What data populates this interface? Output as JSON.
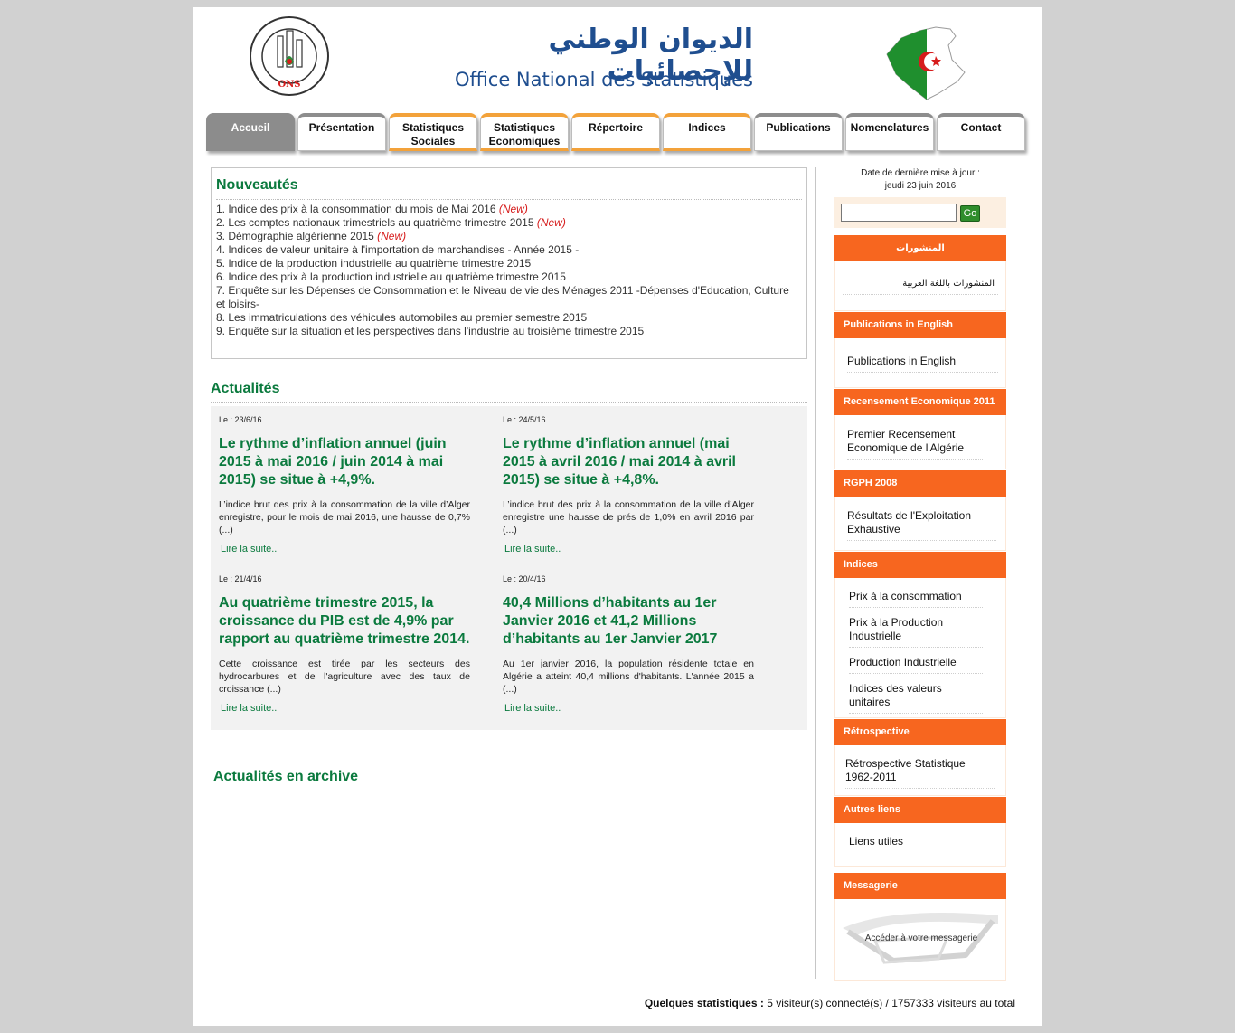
{
  "header": {
    "title_ar": "الديوان الوطني للإحصائيات",
    "title_fr": "Office National des Statistiques",
    "logo_text": "ONS",
    "logo_arc_text": "الديوان الوطني للإحصائيات"
  },
  "nav": [
    {
      "label": "Accueil",
      "active": true
    },
    {
      "label": "Présentation"
    },
    {
      "label": "Statistiques Sociales"
    },
    {
      "label": "Statistiques Economiques"
    },
    {
      "label": "Répertoire"
    },
    {
      "label": "Indices"
    },
    {
      "label": "Publications"
    },
    {
      "label": "Nomenclatures"
    },
    {
      "label": "Contact"
    }
  ],
  "nouveautes": {
    "title": "Nouveautés",
    "new_tag": "(New)",
    "items": [
      {
        "text": "1. Indice des prix à la consommation du mois de Mai 2016",
        "is_new": true
      },
      {
        "text": "2. Les comptes nationaux trimestriels au quatrième trimestre 2015",
        "is_new": true
      },
      {
        "text": "3. Démographie algérienne 2015",
        "is_new": true
      },
      {
        "text": "4. Indices de valeur unitaire à l'importation de marchandises - Année 2015 -"
      },
      {
        "text": "5. Indice de la production industrielle au quatrième trimestre 2015"
      },
      {
        "text": "6. Indice des prix à la production industrielle au quatrième trimestre 2015"
      },
      {
        "text": "7. Enquête sur les Dépenses de Consommation et le Niveau de vie des Ménages 2011 -Dépenses d'Education, Culture et loisirs-"
      },
      {
        "text": "8. Les immatriculations des véhicules automobiles au premier semestre 2015"
      },
      {
        "text": "9. Enquête sur la situation et les perspectives dans l'industrie au troisième trimestre 2015"
      }
    ]
  },
  "actualites": {
    "title": "Actualités",
    "more_label": "Lire la suite..",
    "items": [
      {
        "date": "Le : 23/6/16",
        "headline": "Le rythme d’inflation annuel (juin 2015 à mai 2016 / juin 2014 à mai 2015) se situe à +4,9%.",
        "body": "L’indice brut des prix à la consommation de la ville d’Alger enregistre, pour le mois de mai 2016, une hausse de 0,7% (...)"
      },
      {
        "date": "Le : 24/5/16",
        "headline": "Le rythme d’inflation annuel (mai 2015 à avril 2016 / mai 2014 à avril 2015) se situe à +4,8%.",
        "body": "L’indice brut des prix à la consommation de la ville d’Alger enregistre une hausse de prés de 1,0% en avril 2016 par (...)"
      },
      {
        "date": "Le : 21/4/16",
        "headline": "Au quatrième trimestre 2015, la croissance du PIB est de 4,9% par rapport au quatrième trimestre 2014.",
        "body": "Cette croissance est tirée par les secteurs des hydrocarbures et de l'agriculture avec des taux de croissance (...)"
      },
      {
        "date": "Le : 20/4/16",
        "headline": "40,4 Millions d’habitants au 1er Janvier 2016 et 41,2 Millions d’habitants au 1er Janvier 2017",
        "body": "Au 1er janvier 2016, la population résidente totale en Algérie a atteint 40,4 millions d'habitants. L'année 2015 a (...)"
      }
    ]
  },
  "archive_title": "Actualités en archive",
  "sidebar": {
    "update_label": "Date de dernière mise à jour :",
    "update_date": "jeudi 23 juin 2016",
    "search_value": "",
    "go_label": "Go",
    "blocks": [
      {
        "title": "المنشورات",
        "links": [
          "المنشورات باللغة العربية"
        ]
      },
      {
        "title": "Publications in English",
        "links": [
          "Publications in English"
        ]
      },
      {
        "title": "Recensement Economique 2011",
        "links": [
          "Premier Recensement Economique de l'Algérie"
        ]
      },
      {
        "title": "RGPH 2008",
        "links": [
          "Résultats de l'Exploitation Exhaustive"
        ]
      },
      {
        "title": "Indices",
        "links": [
          "Prix à la consommation",
          "Prix à la Production Industrielle",
          "Production Industrielle",
          "Indices des valeurs unitaires"
        ]
      },
      {
        "title": "Rétrospective",
        "links": [
          "Rétrospective Statistique 1962-2011"
        ]
      },
      {
        "title": "Autres liens",
        "links": [
          "Liens utiles"
        ]
      },
      {
        "title": "Messagerie",
        "links": [
          "Accéder à votre messagerie"
        ]
      }
    ]
  },
  "footer": {
    "stats_label": "Quelques statistiques :",
    "stats_text": "5 visiteur(s) connecté(s) / 1757333 visiteurs au total"
  },
  "colors": {
    "accent_orange": "#f7661f",
    "green_title": "#0b7a3e",
    "header_blue": "#1f4e8f",
    "new_red": "#d61c1c"
  }
}
